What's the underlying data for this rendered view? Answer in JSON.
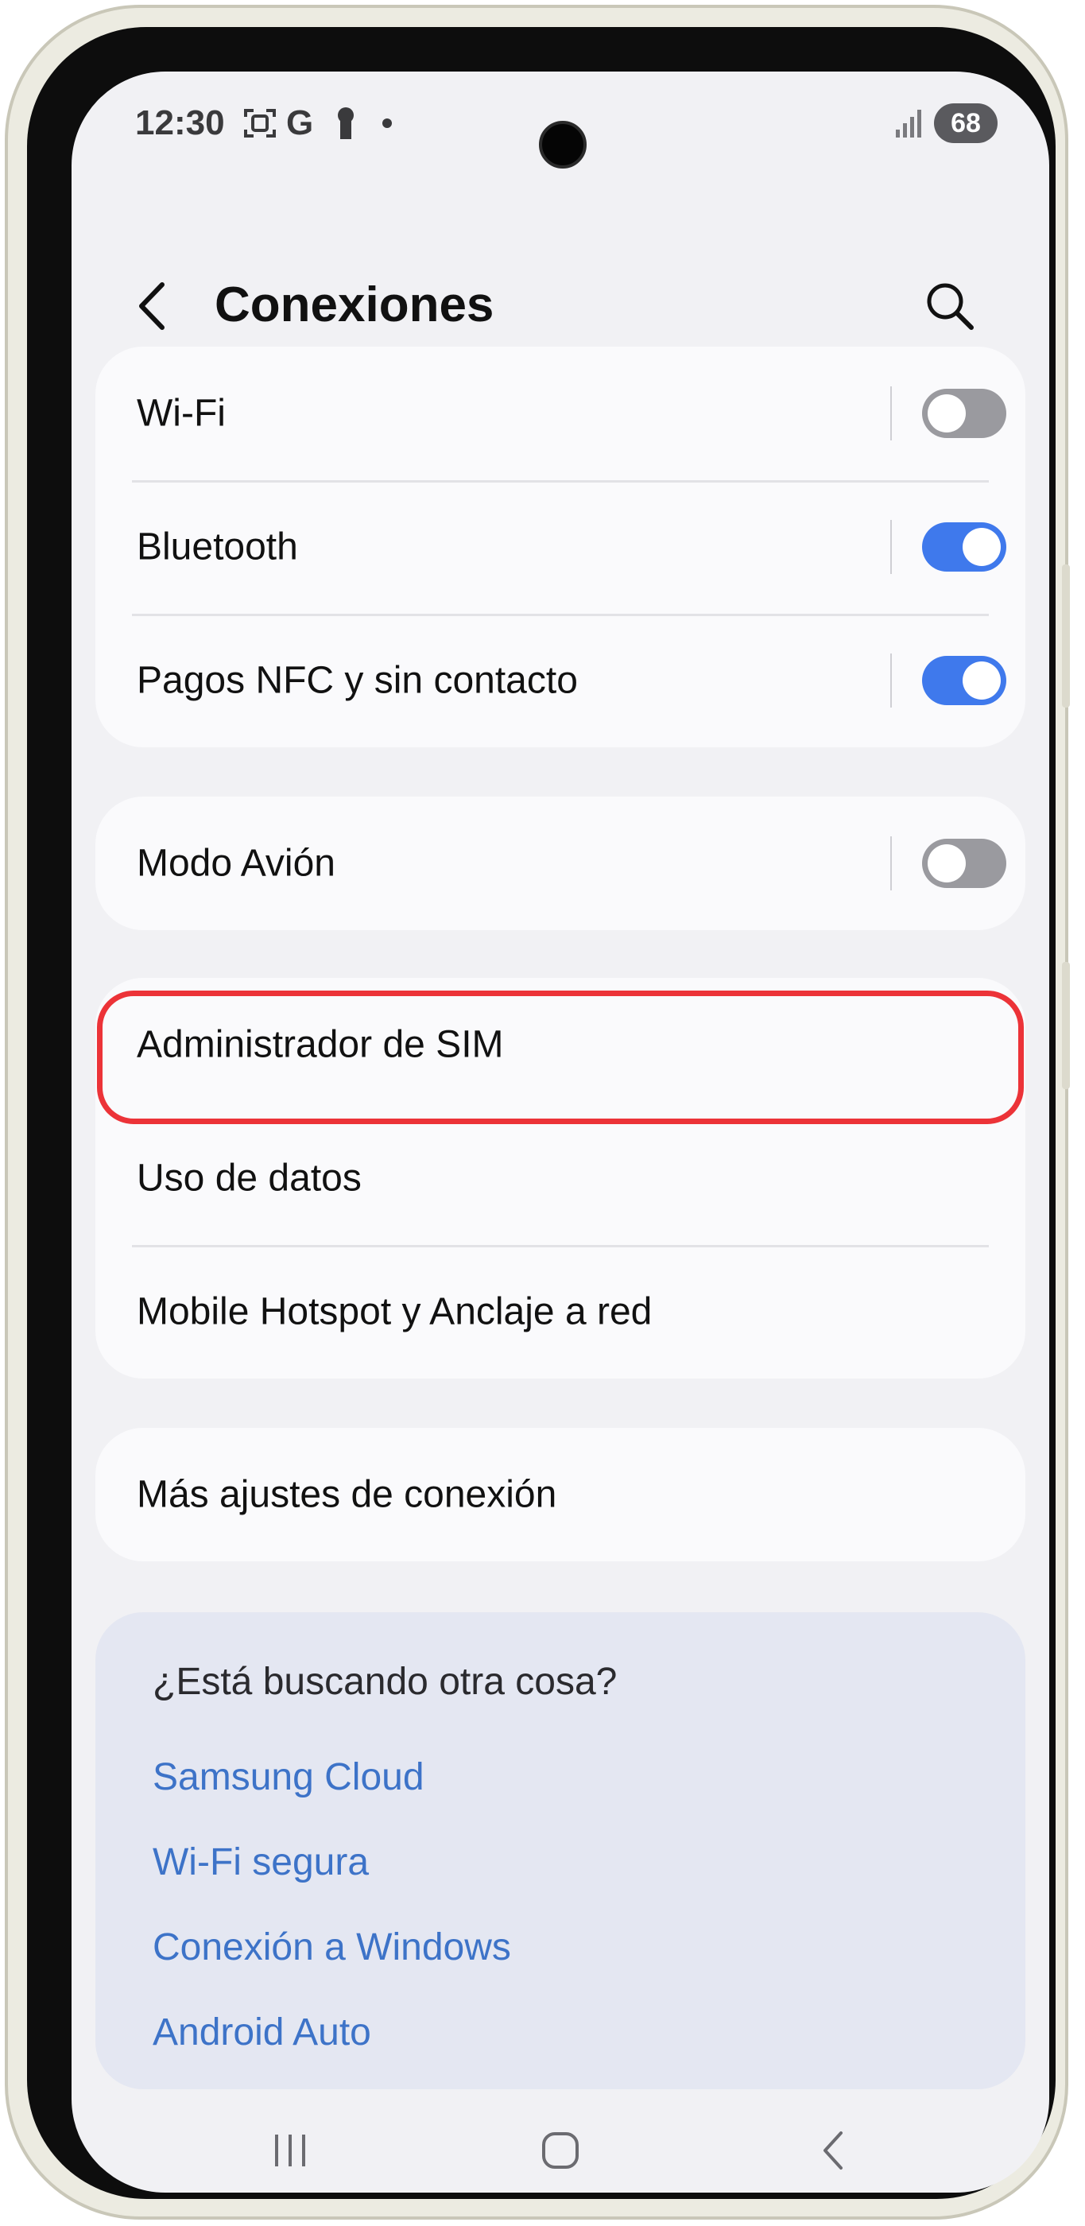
{
  "status_bar": {
    "time": "12:30",
    "icons": [
      "screenshot-icon",
      "google-icon",
      "keyhole-icon",
      "dot-icon"
    ],
    "signal": "signal-icon",
    "battery": "68"
  },
  "header": {
    "title": "Conexiones"
  },
  "groups": [
    {
      "items": [
        {
          "label": "Wi-Fi",
          "toggle": "off"
        },
        {
          "label": "Bluetooth",
          "toggle": "on"
        },
        {
          "label": "Pagos NFC y sin contacto",
          "toggle": "on"
        }
      ]
    },
    {
      "items": [
        {
          "label": "Modo Avión",
          "toggle": "off"
        }
      ]
    },
    {
      "items": [
        {
          "label": "Administrador de SIM"
        },
        {
          "label": "Uso de datos"
        },
        {
          "label": "Mobile Hotspot y Anclaje a red"
        }
      ]
    },
    {
      "items": [
        {
          "label": "Más ajustes de conexión"
        }
      ]
    }
  ],
  "suggestions": {
    "heading": "¿Está buscando otra cosa?",
    "links": [
      "Samsung Cloud",
      "Wi-Fi segura",
      "Conexión a Windows",
      "Android Auto"
    ]
  },
  "colors": {
    "toggle_on": "#3f79ec",
    "toggle_off": "#9a9a9f",
    "highlight": "#ec3338",
    "link": "#3d73c8"
  }
}
